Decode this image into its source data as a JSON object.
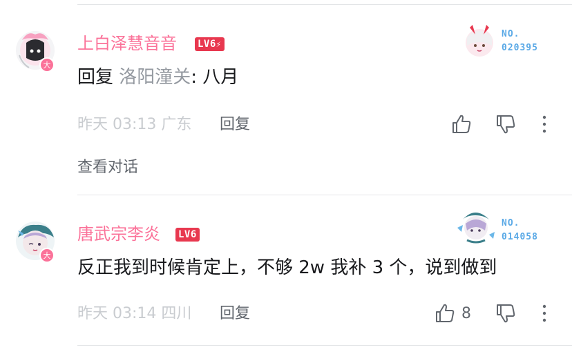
{
  "comments": [
    {
      "username": "上白泽慧音音",
      "level": "LV6",
      "text_prefix": "回复 ",
      "reply_target": "洛阳潼关",
      "text_body": ": 八月",
      "time": "昨天 03:13",
      "location": "广东",
      "reply_label": "回复",
      "likes": "",
      "badge_label": "NO.",
      "badge_number": "020395",
      "view_conversation": "查看对话",
      "avatar_badge": "大"
    },
    {
      "username": "唐武宗李炎",
      "level": "LV6",
      "text_body": "反正我到时候肯定上，不够 2w 我补 3 个，说到做到",
      "time": "昨天 03:14",
      "location": "四川",
      "reply_label": "回复",
      "likes": "8",
      "badge_label": "NO.",
      "badge_number": "014058",
      "avatar_badge": "大"
    }
  ],
  "colors": {
    "username": "#fb7299",
    "level_bg": "#e8384f",
    "meta": "#c9ccd0",
    "divider": "#e3e5e7",
    "badge_no": "#5aa9e6"
  },
  "icons": [
    "thumbs-up-icon",
    "thumbs-down-icon",
    "more-vertical-icon",
    "lightning-icon"
  ]
}
